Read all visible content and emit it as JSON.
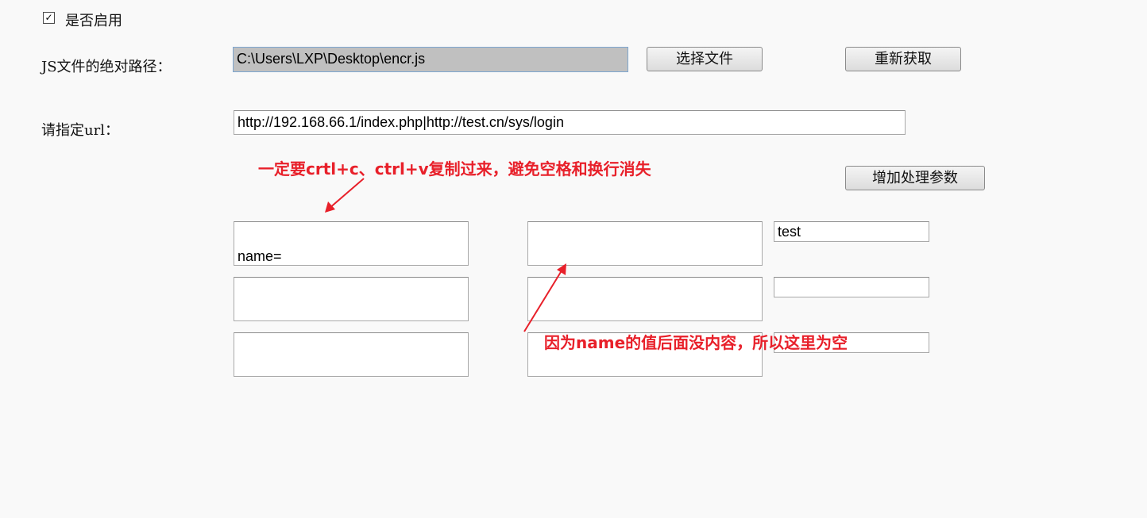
{
  "enable": {
    "checked": true,
    "check_glyph": "✓",
    "label": "是否启用"
  },
  "js_path": {
    "label": "JS文件的绝对路径：",
    "value": "C:\\Users\\LXP\\Desktop\\encr.js",
    "choose_button": "选择文件",
    "refetch_button": "重新获取"
  },
  "url": {
    "label": "请指定url：",
    "value": "http://192.168.66.1/index.php|http://test.cn/sys/login"
  },
  "params": {
    "add_button": "增加处理参数",
    "rows": [
      {
        "left": "name=",
        "middle": "",
        "right": "test"
      },
      {
        "left": "",
        "middle": "",
        "right": ""
      },
      {
        "left": "",
        "middle": "",
        "right": ""
      }
    ]
  },
  "annotations": {
    "copy_note": "一定要crtl+c、ctrl+v复制过来，避免空格和换行消失",
    "empty_note": "因为name的值后面没内容，所以这里为空",
    "color": "#e8202a"
  }
}
